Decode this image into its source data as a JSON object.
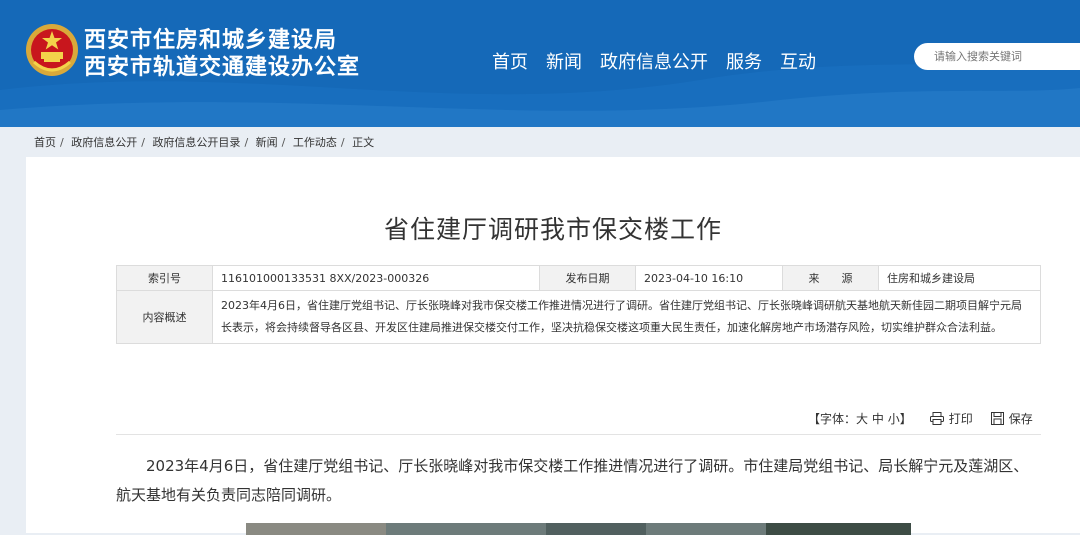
{
  "header": {
    "org_line1": "西安市住房和城乡建设局",
    "org_line2": "西安市轨道交通建设办公室",
    "nav": [
      "首页",
      "新闻",
      "政府信息公开",
      "服务",
      "互动"
    ],
    "search_placeholder": "请输入搜索关键词"
  },
  "breadcrumb": [
    "首页",
    "政府信息公开",
    "政府信息公开目录",
    "新闻",
    "工作动态",
    "正文"
  ],
  "breadcrumb_sep": "/",
  "article": {
    "title": "省住建厅调研我市保交楼工作",
    "meta": {
      "index_label": "索引号",
      "index_value": "116101000133531 8XX/2023-000326",
      "date_label": "发布日期",
      "date_value": "2023-04-10 16:10",
      "source_label": "来　　源",
      "source_value": "住房和城乡建设局",
      "summary_label": "内容概述",
      "summary_value": "2023年4月6日，省住建厅党组书记、厅长张晓峰对我市保交楼工作推进情况进行了调研。省住建厅党组书记、厅长张晓峰调研航天基地航天新佳园二期项目解宁元局长表示，将会持续督导各区县、开发区住建局推进保交楼交付工作，坚决抗稳保交楼这项重大民生责任，加速化解房地产市场潜存风险，切实维护群众合法利益。"
    },
    "tools": {
      "font_prefix": "【字体：",
      "font_large": "大",
      "font_medium": "中",
      "font_small": "小",
      "font_suffix": "】",
      "print": "打印",
      "save": "保存"
    },
    "body": "2023年4月6日，省住建厅党组书记、厅长张晓峰对我市保交楼工作推进情况进行了调研。市住建局党组书记、局长解宁元及莲湖区、航天基地有关负责同志陪同调研。"
  },
  "colors": {
    "header_bg": "#1569b8",
    "panel_bg": "#ffffff",
    "page_bg": "#e9eef4"
  }
}
